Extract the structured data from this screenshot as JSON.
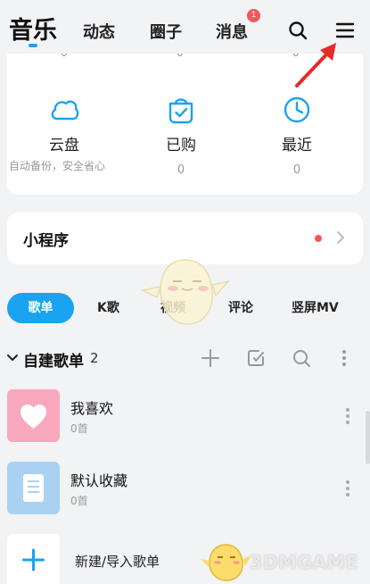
{
  "header": {
    "tabs": [
      {
        "label": "音乐",
        "active": true
      },
      {
        "label": "动态"
      },
      {
        "label": "圈子"
      },
      {
        "label": "消息",
        "badge": "1"
      }
    ],
    "icons": [
      "search-icon",
      "menu-icon"
    ],
    "accent_color": "#1aa3f0",
    "badge_color": "#f25757"
  },
  "top_card": {
    "partial_counts": [
      "0",
      "0",
      "0"
    ],
    "items": [
      {
        "label": "云盘",
        "count": "",
        "sub": "自动备份，安全省心",
        "icon": "cloud-icon"
      },
      {
        "label": "已购",
        "count": "0",
        "icon": "bag-check-icon"
      },
      {
        "label": "最近",
        "count": "0",
        "icon": "clock-icon"
      }
    ]
  },
  "mini_program": {
    "label": "小程序"
  },
  "sub_tabs": [
    {
      "label": "歌单",
      "active": true
    },
    {
      "label": "K歌"
    },
    {
      "label": "视频"
    },
    {
      "label": "评论"
    },
    {
      "label": "竖屏MV"
    }
  ],
  "section": {
    "title": "自建歌单",
    "count": "2",
    "icons": [
      "add-icon",
      "import-icon",
      "search-icon",
      "more-icon"
    ]
  },
  "playlists": [
    {
      "name": "我喜欢",
      "count": "0首",
      "cover": "heart-cover",
      "cover_color": "#f7a8bd"
    },
    {
      "name": "默认收藏",
      "count": "0首",
      "cover": "document-cover",
      "cover_color": "#a9d2f2"
    }
  ],
  "new_playlist": {
    "label": "新建/导入歌单"
  },
  "watermark": {
    "text": "3DMGAME"
  }
}
